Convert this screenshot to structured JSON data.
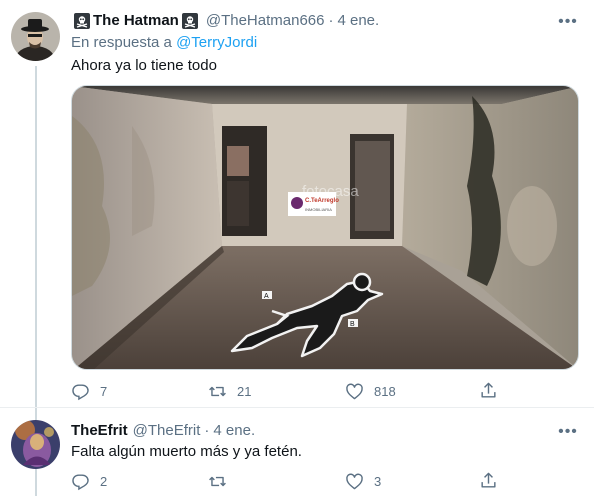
{
  "tweets": [
    {
      "name": "The Hatman",
      "handle": "@TheHatman666",
      "separator": "·",
      "date": "4 ene.",
      "replying_prefix": "En respuesta a",
      "replying_to": "@TerryJordi",
      "text": "Ahora ya lo tiene todo",
      "stats": {
        "replies": "7",
        "retweets": "21",
        "likes": "818"
      },
      "media": {
        "watermark": "fotocasa",
        "sign_brand": "C.TeArreglo",
        "sign_sub": "INMOBILIARIA",
        "marker_a": "A",
        "marker_b": "B"
      }
    },
    {
      "name": "TheEfrit",
      "handle": "@TheEfrit",
      "separator": "·",
      "date": "4 ene.",
      "text": "Falta algún muerto más y ya fetén.",
      "stats": {
        "replies": "2",
        "retweets": "",
        "likes": "3"
      }
    }
  ],
  "colors": {
    "accent": "#1da1f2",
    "secondary_text": "#5b7083",
    "divider": "#ebeef0"
  },
  "icons": [
    "skull-crossbones-icon",
    "reply-icon",
    "retweet-icon",
    "like-icon",
    "share-icon",
    "more-icon"
  ]
}
